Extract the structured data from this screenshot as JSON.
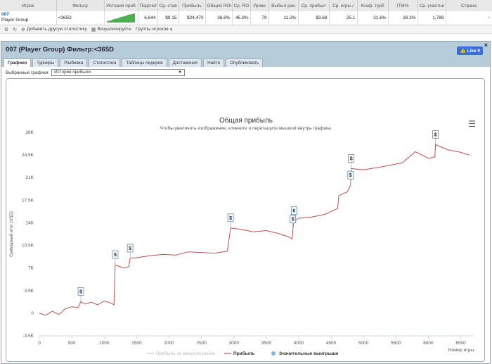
{
  "table": {
    "headers": [
      "Игрок",
      "Фильтр",
      "История приб",
      "Подсчет",
      "Ср. став",
      "Прибыль",
      "Общий ROI",
      "Ср. RO",
      "Урове",
      "Выбыл ран",
      "Ср. прибыл",
      "Ср. игры /",
      "Коэф. турб",
      "ITM%",
      "Ср. участни",
      "Страна"
    ],
    "row": {
      "player_id": "007",
      "player_group": "Player Group",
      "filter": "<365D",
      "count": "6,644",
      "avg_stake": "$9.15",
      "profit": "$24,470",
      "total_roi": "36.6%",
      "avg_roi": "45.9%",
      "level": "79",
      "early_out": "11.2%",
      "avg_profit": "$3.68",
      "avg_games": "25.1",
      "turbo_ratio": "31.6%",
      "itm": "28.3%",
      "avg_entrants": "1,789",
      "country": ""
    }
  },
  "toolbar": {
    "add_stat": "Добавить другую статистику",
    "visualize": "Визуализируйте",
    "groups": "Группы игроков"
  },
  "panel": {
    "title": "007 (Player Group) Фильтр:<365D",
    "like": "Like 0",
    "tabs": [
      "Графики",
      "Турниры",
      "Разбивка",
      "Статистика",
      "Таблицы лидеров",
      "Достижения",
      "Найти",
      "Опубликовать"
    ],
    "select_label": "Выбранные графики:",
    "select_value": "История прибыли"
  },
  "chart_data": {
    "type": "line",
    "title": "Общая прибыль",
    "subtitle": "Чтобы увеличить изображение, кликните и перетащите мышкой внутрь графика.",
    "xlabel": "Номер игры",
    "ylabel": "Суммарный итог (USD)",
    "xlim": [
      0,
      6700
    ],
    "ylim": [
      -3500,
      28000
    ],
    "xticks": [
      0,
      500,
      1000,
      1500,
      2000,
      2500,
      3000,
      3500,
      4000,
      4500,
      5000,
      5500,
      6000,
      6500
    ],
    "yticks": [
      -3500,
      0,
      3500,
      7000,
      10500,
      14000,
      17500,
      21000,
      24500,
      28000
    ],
    "ytick_labels": [
      "-3.5K",
      "0",
      "3.5K",
      "7K",
      "10.5K",
      "14K",
      "17.5K",
      "21K",
      "24.5K",
      "28K"
    ],
    "series": [
      {
        "name": "Прибыль за минусом рейка",
        "color": "#cccccc",
        "values": []
      },
      {
        "name": "Прибыль",
        "color": "#c0504d",
        "points": [
          [
            0,
            0
          ],
          [
            100,
            -300
          ],
          [
            200,
            300
          ],
          [
            300,
            -200
          ],
          [
            400,
            700
          ],
          [
            500,
            1000
          ],
          [
            600,
            900
          ],
          [
            640,
            1800
          ],
          [
            700,
            1400
          ],
          [
            800,
            1700
          ],
          [
            900,
            1300
          ],
          [
            1000,
            1900
          ],
          [
            1100,
            1600
          ],
          [
            1150,
            1300
          ],
          [
            1170,
            7500
          ],
          [
            1300,
            7000
          ],
          [
            1380,
            7200
          ],
          [
            1400,
            8500
          ],
          [
            1500,
            8600
          ],
          [
            1700,
            8900
          ],
          [
            1900,
            9100
          ],
          [
            2100,
            9000
          ],
          [
            2300,
            9500
          ],
          [
            2500,
            9400
          ],
          [
            2700,
            9300
          ],
          [
            2900,
            9600
          ],
          [
            2950,
            13200
          ],
          [
            3100,
            13000
          ],
          [
            3300,
            12600
          ],
          [
            3500,
            12800
          ],
          [
            3700,
            12300
          ],
          [
            3850,
            11800
          ],
          [
            3900,
            11500
          ],
          [
            3910,
            13000
          ],
          [
            3930,
            14300
          ],
          [
            4000,
            14700
          ],
          [
            4200,
            14900
          ],
          [
            4400,
            15300
          ],
          [
            4600,
            16200
          ],
          [
            4620,
            18200
          ],
          [
            4750,
            18800
          ],
          [
            4800,
            19800
          ],
          [
            4810,
            22400
          ],
          [
            5000,
            22200
          ],
          [
            5300,
            22700
          ],
          [
            5600,
            23300
          ],
          [
            5800,
            25000
          ],
          [
            6000,
            24000
          ],
          [
            6100,
            24200
          ],
          [
            6110,
            26100
          ],
          [
            6300,
            25300
          ],
          [
            6500,
            24900
          ],
          [
            6630,
            24500
          ]
        ]
      },
      {
        "name": "Значительные выигрыши",
        "color": "#7cb5ec",
        "values": []
      }
    ],
    "markers": [
      {
        "x": 640,
        "y": 1800,
        "label": "$"
      },
      {
        "x": 1170,
        "y": 7500,
        "label": "$"
      },
      {
        "x": 1400,
        "y": 8500,
        "label": "$"
      },
      {
        "x": 2950,
        "y": 13200,
        "label": "$"
      },
      {
        "x": 3910,
        "y": 13000,
        "label": "$"
      },
      {
        "x": 3930,
        "y": 14300,
        "label": "€"
      },
      {
        "x": 4800,
        "y": 19800,
        "label": "$"
      },
      {
        "x": 4810,
        "y": 22400,
        "label": "$"
      },
      {
        "x": 6110,
        "y": 26100,
        "label": "$"
      }
    ],
    "legend_position": "bottom-center",
    "grid": false
  }
}
